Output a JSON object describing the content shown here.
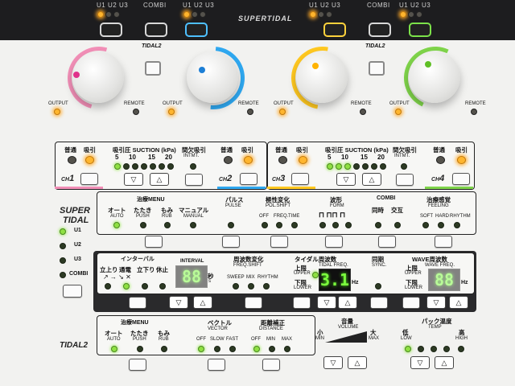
{
  "top": {
    "u1": "U1",
    "u2": "U2",
    "u3": "U3",
    "combi": "COMBI",
    "brand": "SUPERTIDAL"
  },
  "tidal2": "TIDAL2",
  "knobs": {
    "output": "OUTPUT",
    "remote": "REMOTE"
  },
  "colors": {
    "ch1": "#f28fb7",
    "ch2": "#2fa8f0",
    "ch3": "#ffc820",
    "ch4": "#7fd44a",
    "led_on": "#ffb52e",
    "seg_green": "#7cff3e"
  },
  "suction": {
    "futsu": "普通",
    "kyuin": "吸引",
    "title": "吸引圧 SUCTION (kPa)",
    "kanketsu": "間欠吸引",
    "intmt": "INTMT.",
    "scale": [
      "5",
      "10",
      "15",
      "20"
    ],
    "ch": [
      "CH",
      "1",
      "2",
      "3",
      "4"
    ]
  },
  "side": {
    "super": "SUPER",
    "tidal": "TIDAL",
    "u1": "U1",
    "u2": "U2",
    "u3": "U3",
    "combi": "COMBI"
  },
  "menu": {
    "title": "治療MENU",
    "auto_jp": "オート",
    "auto": "AUTO",
    "push_jp": "たたき",
    "push": "PUSH",
    "rub_jp": "もみ",
    "rub": "RUB",
    "manual_jp": "マニュアル",
    "manual": "MANUAL",
    "pulse_jp": "パルス",
    "pulse": "PULSE",
    "pol_jp": "極性変化",
    "pol": "POL.SHIFT",
    "off": "OFF",
    "freq": "FREQ.",
    "time": "TIME",
    "form_jp": "波形",
    "form": "FORM",
    "combi": "COMBI",
    "douji": "同時",
    "kougo": "交互",
    "feel_jp": "治療感覚",
    "feel": "FEELING",
    "soft": "SOFT",
    "hard": "HARD",
    "rhythm": "RHYTHM"
  },
  "interval": {
    "title": "インターバル",
    "tachiagari": "立上り",
    "tsuuden": "通電",
    "tachisagari": "立下り",
    "kyushi": "休止",
    "label": "INTERVAL",
    "value": "88",
    "unit_jp": "秒",
    "unit": "s",
    "freqshift_jp": "周波数変化",
    "freqshift": "FREQ.SHIFT",
    "sweep": "SWEEP",
    "mix": "MIX",
    "rhythm": "RHYTHM",
    "tidal_jp": "タイダル周波数",
    "tidalfreq": "TIDAL FREQ.",
    "upper_jp": "上限",
    "upper": "UPPER",
    "lower_jp": "下限",
    "lower": "LOWER",
    "tidal_value": "3.1",
    "hz": "Hz",
    "sync_jp": "同期",
    "sync": "SYNC.",
    "wave_jp": "WAVE周波数",
    "wavefreq": "WAVE FREQ.",
    "wave_value": "88"
  },
  "bottom": {
    "menu": "治療MENU",
    "auto_jp": "オート",
    "auto": "AUTO",
    "push_jp": "たたき",
    "push": "PUSH",
    "rub_jp": "もみ",
    "rub": "RUB",
    "vector_jp": "ベクトル",
    "vector": "VECTOR",
    "off": "OFF",
    "slow": "SLOW",
    "fast": "FAST",
    "dist_jp": "距離補正",
    "distance": "DISTANCE",
    "min": "MIN",
    "max": "MAX",
    "vol_jp": "音量",
    "volume": "VOLUME",
    "sho_jp": "小",
    "dai_jp": "大",
    "temp_jp": "パック温度",
    "temp": "TEMP",
    "low_jp": "低",
    "low": "LOW",
    "high_jp": "高",
    "high": "HIGH",
    "tidal2": "TIDAL2"
  }
}
